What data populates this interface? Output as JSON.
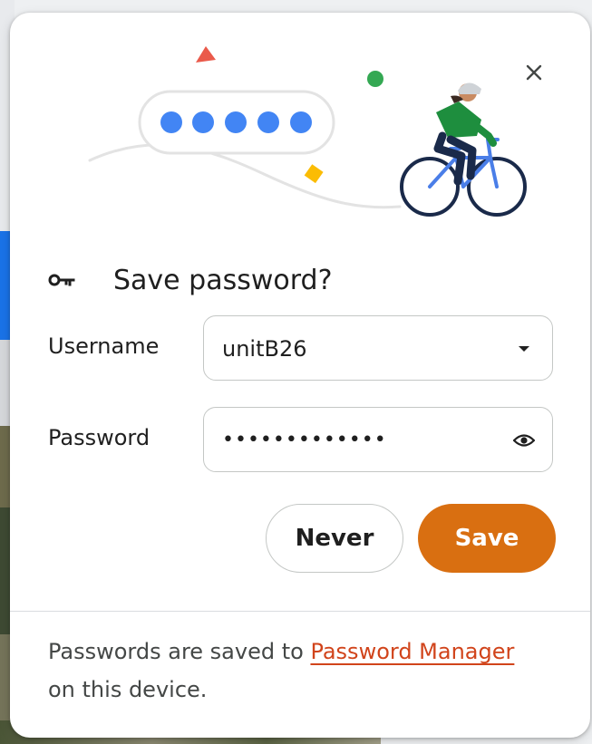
{
  "dialog": {
    "title": "Save password?",
    "close_icon": "close-icon",
    "title_icon": "key-icon",
    "username": {
      "label": "Username",
      "value": "unitB26",
      "icon": "dropdown-arrow-icon"
    },
    "password": {
      "label": "Password",
      "masked_value": "•••••••••••••",
      "icon": "eye-icon"
    },
    "buttons": {
      "never": "Never",
      "save": "Save"
    },
    "footer": {
      "prefix": "Passwords are saved to ",
      "link": "Password Manager",
      "suffix": " on this device."
    }
  },
  "colors": {
    "accent": "#d96f11",
    "link": "#d1441b",
    "illustration_dots": "#4285f4",
    "jersey": "#1e8e3e"
  }
}
